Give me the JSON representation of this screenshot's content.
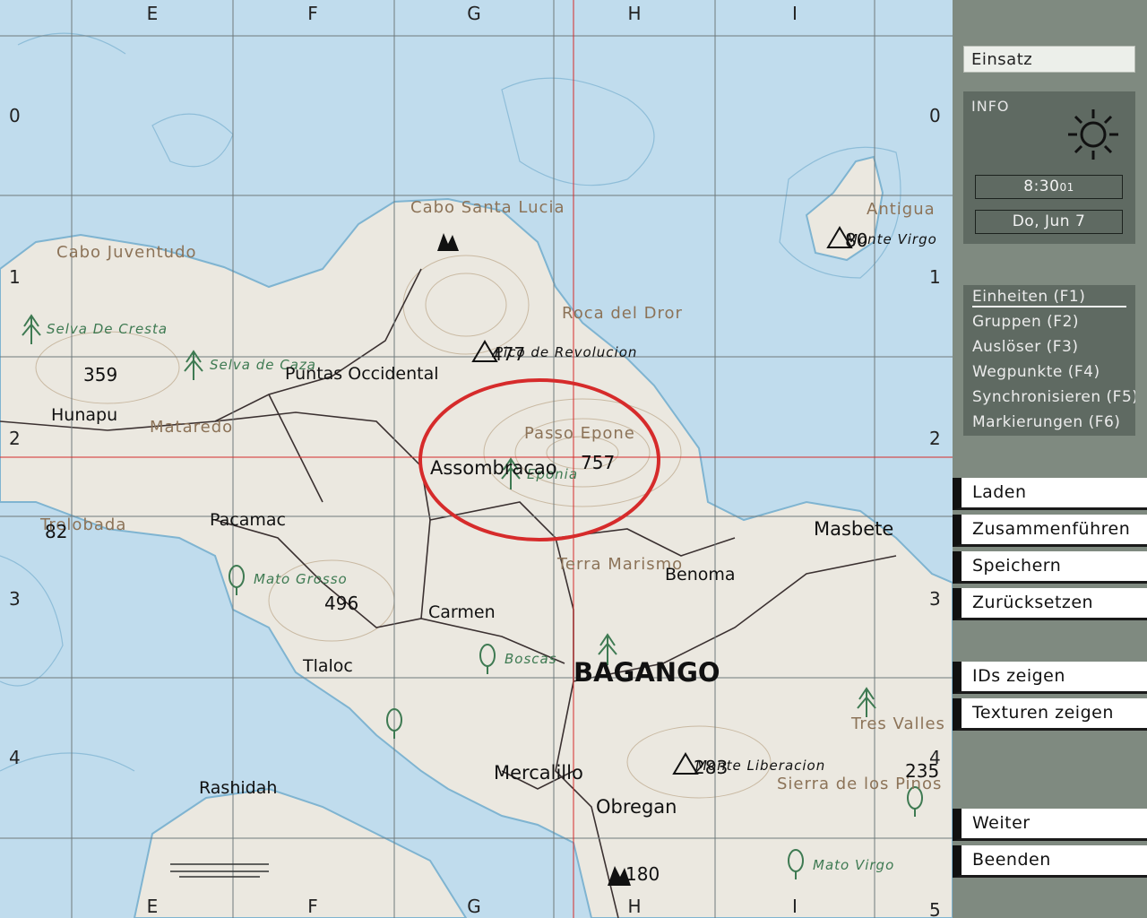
{
  "map": {
    "grid_columns": [
      "E",
      "F",
      "G",
      "H",
      "I"
    ],
    "grid_rows": [
      "0",
      "1",
      "2",
      "3",
      "4",
      "5"
    ],
    "places": [
      "Cabo Santa Lucia",
      "Cabo Juventudo",
      "Antigua",
      "Selva De Cresta",
      "Selva de Caza",
      "Roca del Dror",
      "Pico de Revolucion",
      "Hunapu",
      "Mataredo",
      "Puntas Occidental",
      "Passo Epone",
      "Eponia",
      "Assombracao",
      "Trelobada",
      "Pacamac",
      "Masbete",
      "Terra Marismo",
      "Benoma",
      "Mato Grosso",
      "Carmen",
      "Tlaloc",
      "Boscas",
      "BAGANGO",
      "Tres Valles",
      "Monte Liberacion",
      "Sierra de los Pinos",
      "Mercalillo",
      "Rashidah",
      "Obregan",
      "Mato Virgo",
      "Monte Virgo"
    ],
    "elevations": [
      "359",
      "82",
      "496",
      "757",
      "477",
      "80",
      "283",
      "235",
      "180"
    ]
  },
  "panel": {
    "mode": "Einsatz",
    "info": {
      "title": "INFO",
      "time": "8:30",
      "time_seconds": "01",
      "date": "Do, Jun 7"
    },
    "tabs": [
      "Einheiten (F1)",
      "Gruppen (F2)",
      "Auslöser (F3)",
      "Wegpunkte (F4)",
      "Synchronisieren (F5)",
      "Markierungen (F6)"
    ],
    "buttons": {
      "load": "Laden",
      "merge": "Zusammenführen",
      "save": "Speichern",
      "reset": "Zurücksetzen",
      "show_ids": "IDs zeigen",
      "show_textures": "Texturen zeigen",
      "continue": "Weiter",
      "exit": "Beenden"
    }
  },
  "colors": {
    "sea": "#c0dced",
    "land": "#ebe8e0",
    "grid": "#6f7a7c",
    "marker": "#d62b2b",
    "panel_bg": "#7f8a80",
    "panel_box": "#5f6a62"
  }
}
